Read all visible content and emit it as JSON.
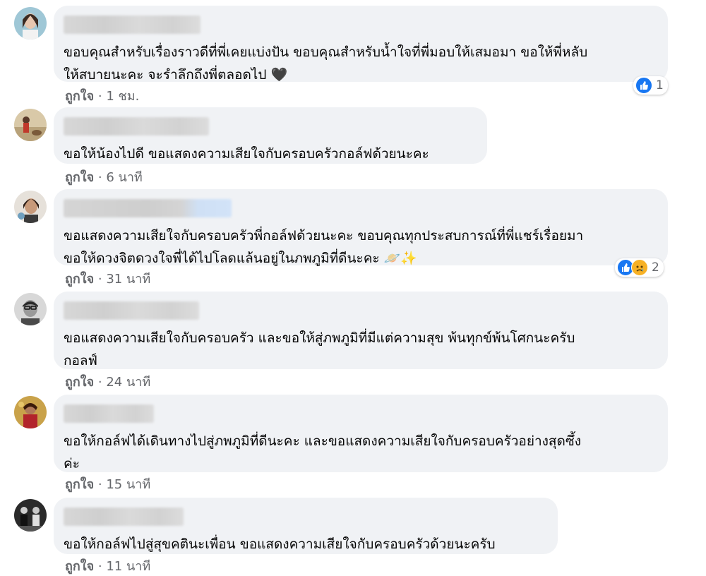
{
  "comments": [
    {
      "text": "ขอบคุณสำหรับเรื่องราวดีที่พี่เคยแบ่งปัน ขอบคุณสำหรับน้ำใจที่พี่มอบให้เสมอมา ขอให้พี่หลับ\nให้สบายนะคะ จะรำลึกถึงพี่ตลอดไป 🖤",
      "like_label": "ถูกใจ",
      "time": "1 ชม.",
      "reaction_count": "1"
    },
    {
      "text": "ขอให้น้องไปดี ขอแสดงความเสียใจกับครอบครัวกอล์ฟด้วยนะคะ",
      "like_label": "ถูกใจ",
      "time": "6 นาที"
    },
    {
      "text": "ขอแสดงความเสียใจกับครอบครัวพี่กอล์ฟด้วยนะคะ ขอบคุณทุกประสบการณ์ที่พี่แชร์เรื่อยมา\nขอให้ดวงจิตดวงใจพี่ได้ไปโลดแล้นอยู่ในภพภูมิที่ดีนะคะ 🪐✨",
      "like_label": "ถูกใจ",
      "time": "31 นาที",
      "reaction_count": "2"
    },
    {
      "text": "ขอแสดงความเสียใจกับครอบครัว และขอให้สู่ภพภูมิที่มีแต่ความสุข พ้นทุกข์พ้นโศกนะครับ\nกอลฟ์",
      "like_label": "ถูกใจ",
      "time": "24 นาที"
    },
    {
      "text": "ขอให้กอล์ฟได้เดินทางไปสู่ภพภูมิที่ดีนะคะ และขอแสดงความเสียใจกับครอบครัวอย่างสุดซึ้ง\nค่ะ",
      "like_label": "ถูกใจ",
      "time": "15 นาที"
    },
    {
      "text": "ขอให้กอล์ฟไปสู่สุขคตินะเพื่อน ขอแสดงความเสียใจกับครอบครัวด้วยนะครับ",
      "like_label": "ถูกใจ",
      "time": "11 นาที"
    }
  ],
  "separator": "·",
  "colors": {
    "bubble": "#f0f2f5",
    "meta_text": "#65676b",
    "like_blue": "#1877f2",
    "sad_yellow": "#f7b125"
  }
}
